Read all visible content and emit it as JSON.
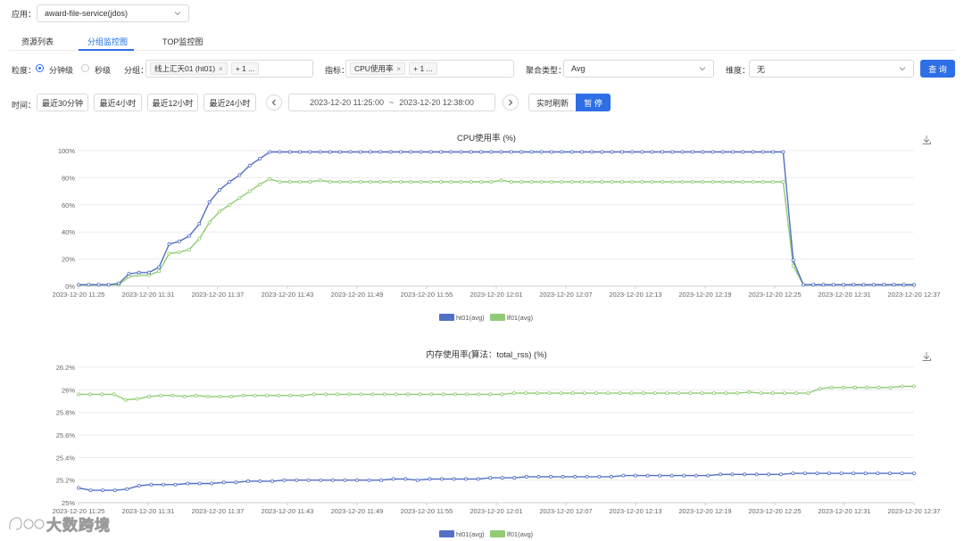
{
  "app": {
    "label": "应用：",
    "value": "award-file-service(jdos)"
  },
  "tabs": [
    {
      "label": "资源列表"
    },
    {
      "label": "分组监控图"
    },
    {
      "label": "TOP监控图"
    }
  ],
  "filters": {
    "granularity_label": "粒度：",
    "granularity_options": [
      "分钟级",
      "秒级"
    ],
    "group_label": "分组：",
    "group_tag": "线上汇天01 (ht01)",
    "group_more": "+ 1 ...",
    "metric_label": "指标：",
    "metric_tag": "CPU使用率",
    "metric_more": "+ 1 ...",
    "agg_label": "聚合类型：",
    "agg_value": "Avg",
    "dim_label": "维度：",
    "dim_value": "无",
    "query_button": "查 询"
  },
  "time": {
    "label": "时间：",
    "quick": [
      "最近30分钟",
      "最近4小时",
      "最近12小时",
      "最近24小时"
    ],
    "start": "2023-12-20 11:25:00",
    "sep": "~",
    "end": "2023-12-20 12:38:00",
    "realtime_button": "实时刷新",
    "pause_button": "暂 停"
  },
  "watermark": "大数跨境",
  "colors": {
    "series1": "#5470c6",
    "series2": "#91cc75",
    "accent": "#2f6fe6"
  },
  "icons": [
    "download-icon",
    "chevron-left-icon",
    "chevron-right-icon",
    "chevron-down-icon"
  ],
  "chart_data": [
    {
      "type": "line",
      "title": "CPU使用率 (%)",
      "x_ticks": [
        "2023-12-20 11:25",
        "2023-12-20 11:31",
        "2023-12-20 11:37",
        "2023-12-20 11:43",
        "2023-12-20 11:49",
        "2023-12-20 11:55",
        "2023-12-20 12:01",
        "2023-12-20 12:07",
        "2023-12-20 12:13",
        "2023-12-20 12:19",
        "2023-12-20 12:25",
        "2023-12-20 12:31",
        "2023-12-20 12:37"
      ],
      "y_ticks": [
        "0%",
        "20%",
        "40%",
        "60%",
        "80%",
        "100%"
      ],
      "ylim": [
        0,
        100
      ],
      "series": [
        {
          "name": "ht01(avg)",
          "values": [
            1,
            1,
            1,
            1,
            2,
            9,
            10,
            10,
            14,
            31,
            33,
            37,
            46,
            62,
            71,
            77,
            82,
            89,
            94,
            99,
            99,
            99,
            99,
            99,
            99,
            99,
            99,
            99,
            99,
            99,
            99,
            99,
            99,
            99,
            99,
            99,
            99,
            99,
            99,
            99,
            99,
            99,
            99,
            99,
            99,
            99,
            99,
            99,
            99,
            99,
            99,
            99,
            99,
            99,
            99,
            99,
            99,
            99,
            99,
            99,
            99,
            99,
            99,
            99,
            99,
            99,
            99,
            99,
            99,
            99,
            99,
            19,
            1,
            1,
            1,
            1,
            1,
            1,
            1,
            1,
            1,
            1,
            1,
            1
          ]
        },
        {
          "name": "lf01(avg)",
          "values": [
            1,
            1,
            1,
            1,
            1,
            7,
            8,
            8,
            11,
            24,
            25,
            27,
            35,
            47,
            55,
            60,
            65,
            70,
            75,
            79,
            77,
            77,
            77,
            77,
            78,
            77,
            77,
            77,
            77,
            77,
            77,
            77,
            77,
            77,
            77,
            77,
            77,
            77,
            77,
            77,
            77,
            77,
            78,
            77,
            77,
            77,
            77,
            77,
            77,
            77,
            77,
            77,
            77,
            77,
            77,
            77,
            77,
            77,
            77,
            77,
            77,
            77,
            77,
            77,
            77,
            77,
            77,
            77,
            77,
            77,
            77,
            15,
            1,
            1,
            1,
            1,
            1,
            1,
            1,
            1,
            1,
            1,
            1,
            1
          ]
        }
      ],
      "legend": "bottom"
    },
    {
      "type": "line",
      "title": "内存使用率(算法：total_rss) (%)",
      "x_ticks": [
        "2023-12-20 11:25",
        "2023-12-20 11:31",
        "2023-12-20 11:37",
        "2023-12-20 11:43",
        "2023-12-20 11:49",
        "2023-12-20 11:55",
        "2023-12-20 12:01",
        "2023-12-20 12:07",
        "2023-12-20 12:13",
        "2023-12-20 12:19",
        "2023-12-20 12:25",
        "2023-12-20 12:31",
        "2023-12-20 12:37"
      ],
      "y_ticks": [
        "25%",
        "25.2%",
        "25.4%",
        "25.6%",
        "25.8%",
        "26%",
        "26.2%"
      ],
      "ylim": [
        25,
        26.2
      ],
      "series": [
        {
          "name": "ht01(avg)",
          "values": [
            25.13,
            25.11,
            25.11,
            25.11,
            25.12,
            25.15,
            25.16,
            25.16,
            25.16,
            25.17,
            25.17,
            25.17,
            25.18,
            25.18,
            25.19,
            25.19,
            25.19,
            25.2,
            25.2,
            25.2,
            25.2,
            25.2,
            25.2,
            25.2,
            25.2,
            25.2,
            25.21,
            25.21,
            25.2,
            25.21,
            25.21,
            25.21,
            25.21,
            25.21,
            25.22,
            25.22,
            25.22,
            25.23,
            25.23,
            25.23,
            25.23,
            25.23,
            25.23,
            25.23,
            25.23,
            25.24,
            25.24,
            25.24,
            25.24,
            25.24,
            25.24,
            25.24,
            25.24,
            25.25,
            25.25,
            25.25,
            25.25,
            25.25,
            25.25,
            25.26,
            25.26,
            25.26,
            25.26,
            25.26,
            25.26,
            25.26,
            25.26,
            25.26,
            25.26,
            25.26
          ]
        },
        {
          "name": "lf01(avg)",
          "values": [
            25.96,
            25.96,
            25.96,
            25.96,
            25.91,
            25.92,
            25.94,
            25.95,
            25.95,
            25.94,
            25.95,
            25.94,
            25.94,
            25.94,
            25.95,
            25.95,
            25.95,
            25.95,
            25.95,
            25.95,
            25.96,
            25.96,
            25.96,
            25.96,
            25.96,
            25.96,
            25.96,
            25.96,
            25.96,
            25.96,
            25.96,
            25.96,
            25.96,
            25.96,
            25.96,
            25.96,
            25.96,
            25.97,
            25.97,
            25.97,
            25.97,
            25.97,
            25.97,
            25.97,
            25.97,
            25.97,
            25.97,
            25.97,
            25.97,
            25.97,
            25.97,
            25.97,
            25.97,
            25.97,
            25.97,
            25.97,
            25.97,
            25.98,
            25.97,
            25.97,
            25.97,
            25.97,
            25.97,
            26.01,
            26.02,
            26.02,
            26.02,
            26.02,
            26.02,
            26.02,
            26.03,
            26.03
          ]
        }
      ],
      "legend": "bottom"
    }
  ]
}
